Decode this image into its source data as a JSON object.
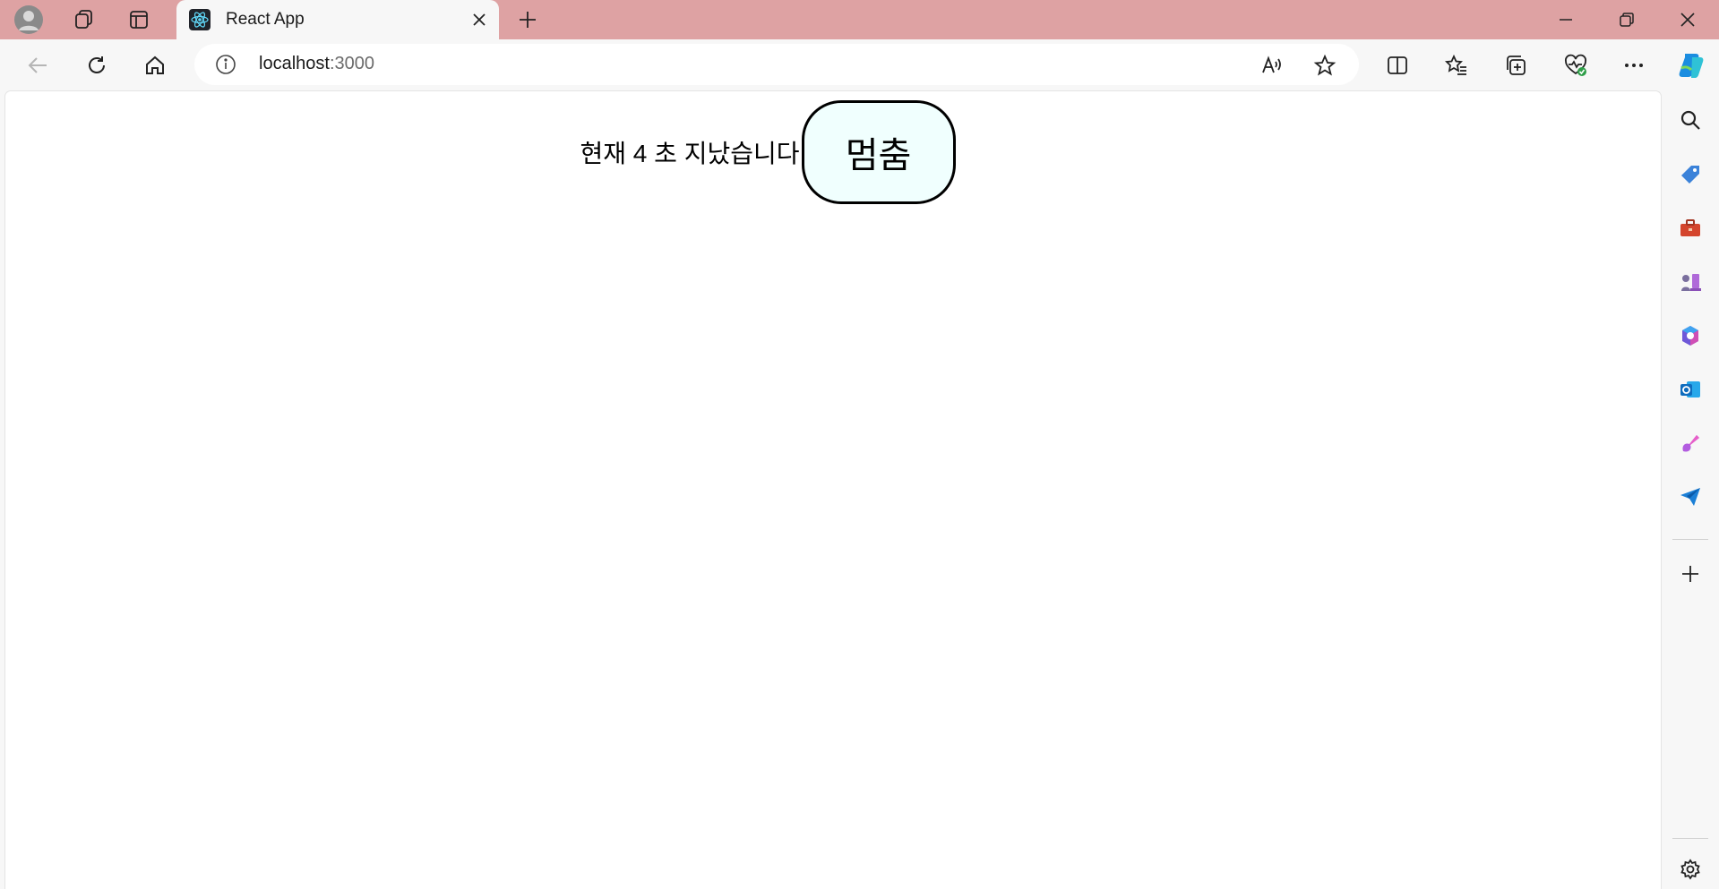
{
  "browser": {
    "tab": {
      "title": "React App",
      "favicon": "react-logo-icon",
      "close_icon": "close-icon"
    },
    "new_tab_icon": "plus-icon",
    "address": {
      "host": "localhost",
      "port": ":3000"
    },
    "colors": {
      "titlebar": "#dea2a3",
      "toolbar": "#f7f7f7",
      "copilot": "#1b8de0"
    },
    "toolbar_icons": [
      "back-arrow-icon",
      "refresh-icon",
      "home-icon",
      "info-icon",
      "read-aloud-icon",
      "favorite-star-icon",
      "split-screen-icon",
      "favorites-icon",
      "collections-icon",
      "browser-essentials-icon",
      "more-icon",
      "copilot-icon"
    ],
    "sidebar_icons": [
      "search-icon",
      "shopping-tag-icon",
      "tools-icon",
      "games-icon",
      "microsoft-365-icon",
      "outlook-icon",
      "designer-icon",
      "drop-icon",
      "add-icon",
      "settings-icon"
    ]
  },
  "page": {
    "timer_text": "현재 4 초 지났습니다",
    "stop_button_label": "멈춤",
    "stop_button_bg": "#f0fffe"
  }
}
